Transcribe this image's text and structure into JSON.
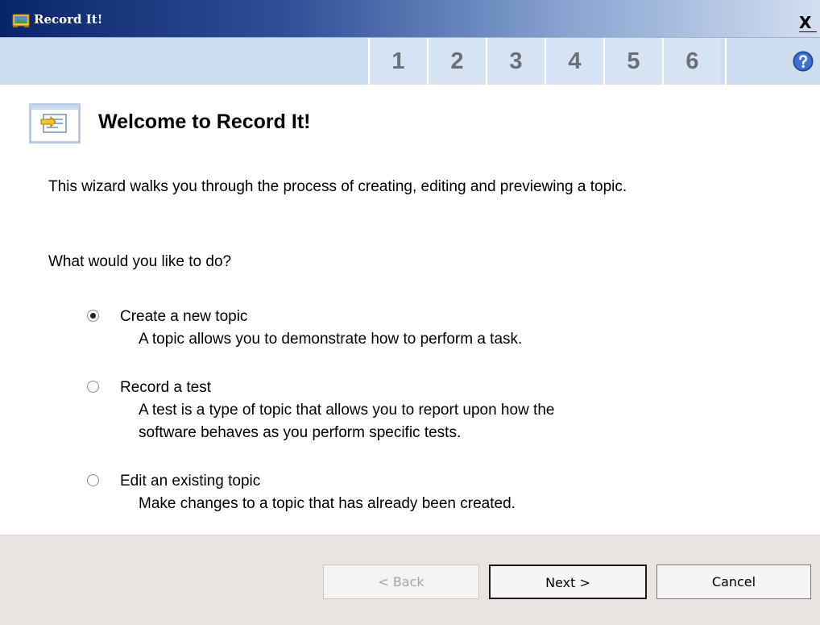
{
  "window": {
    "title": "Record It!",
    "icons": {
      "app": "record-app-icon",
      "close": "close-icon",
      "help": "help-icon",
      "header": "wizard-document-icon"
    },
    "close_label": "X"
  },
  "steps": {
    "items": [
      "1",
      "2",
      "3",
      "4",
      "5",
      "6"
    ]
  },
  "page": {
    "title": "Welcome to Record It!",
    "intro": "This wizard walks you through the process of creating, editing and previewing a topic.",
    "prompt": "What would you like to do?"
  },
  "options": [
    {
      "label": "Create a new topic",
      "description": "A topic allows you to demonstrate how to perform a task.",
      "selected": true
    },
    {
      "label": "Record a test",
      "description": "A test is a type of topic that allows you to report upon how the\nsoftware behaves as you perform specific tests.",
      "selected": false
    },
    {
      "label": "Edit an existing topic",
      "description": "Make changes to a topic that has already been created.",
      "selected": false
    }
  ],
  "buttons": {
    "back": "< Back",
    "next": "Next >",
    "cancel": "Cancel"
  },
  "colors": {
    "title_bar_start": "#0a246a",
    "title_bar_end": "#d4def0",
    "step_bar": "#cddcee",
    "footer": "#e8e5e1"
  }
}
